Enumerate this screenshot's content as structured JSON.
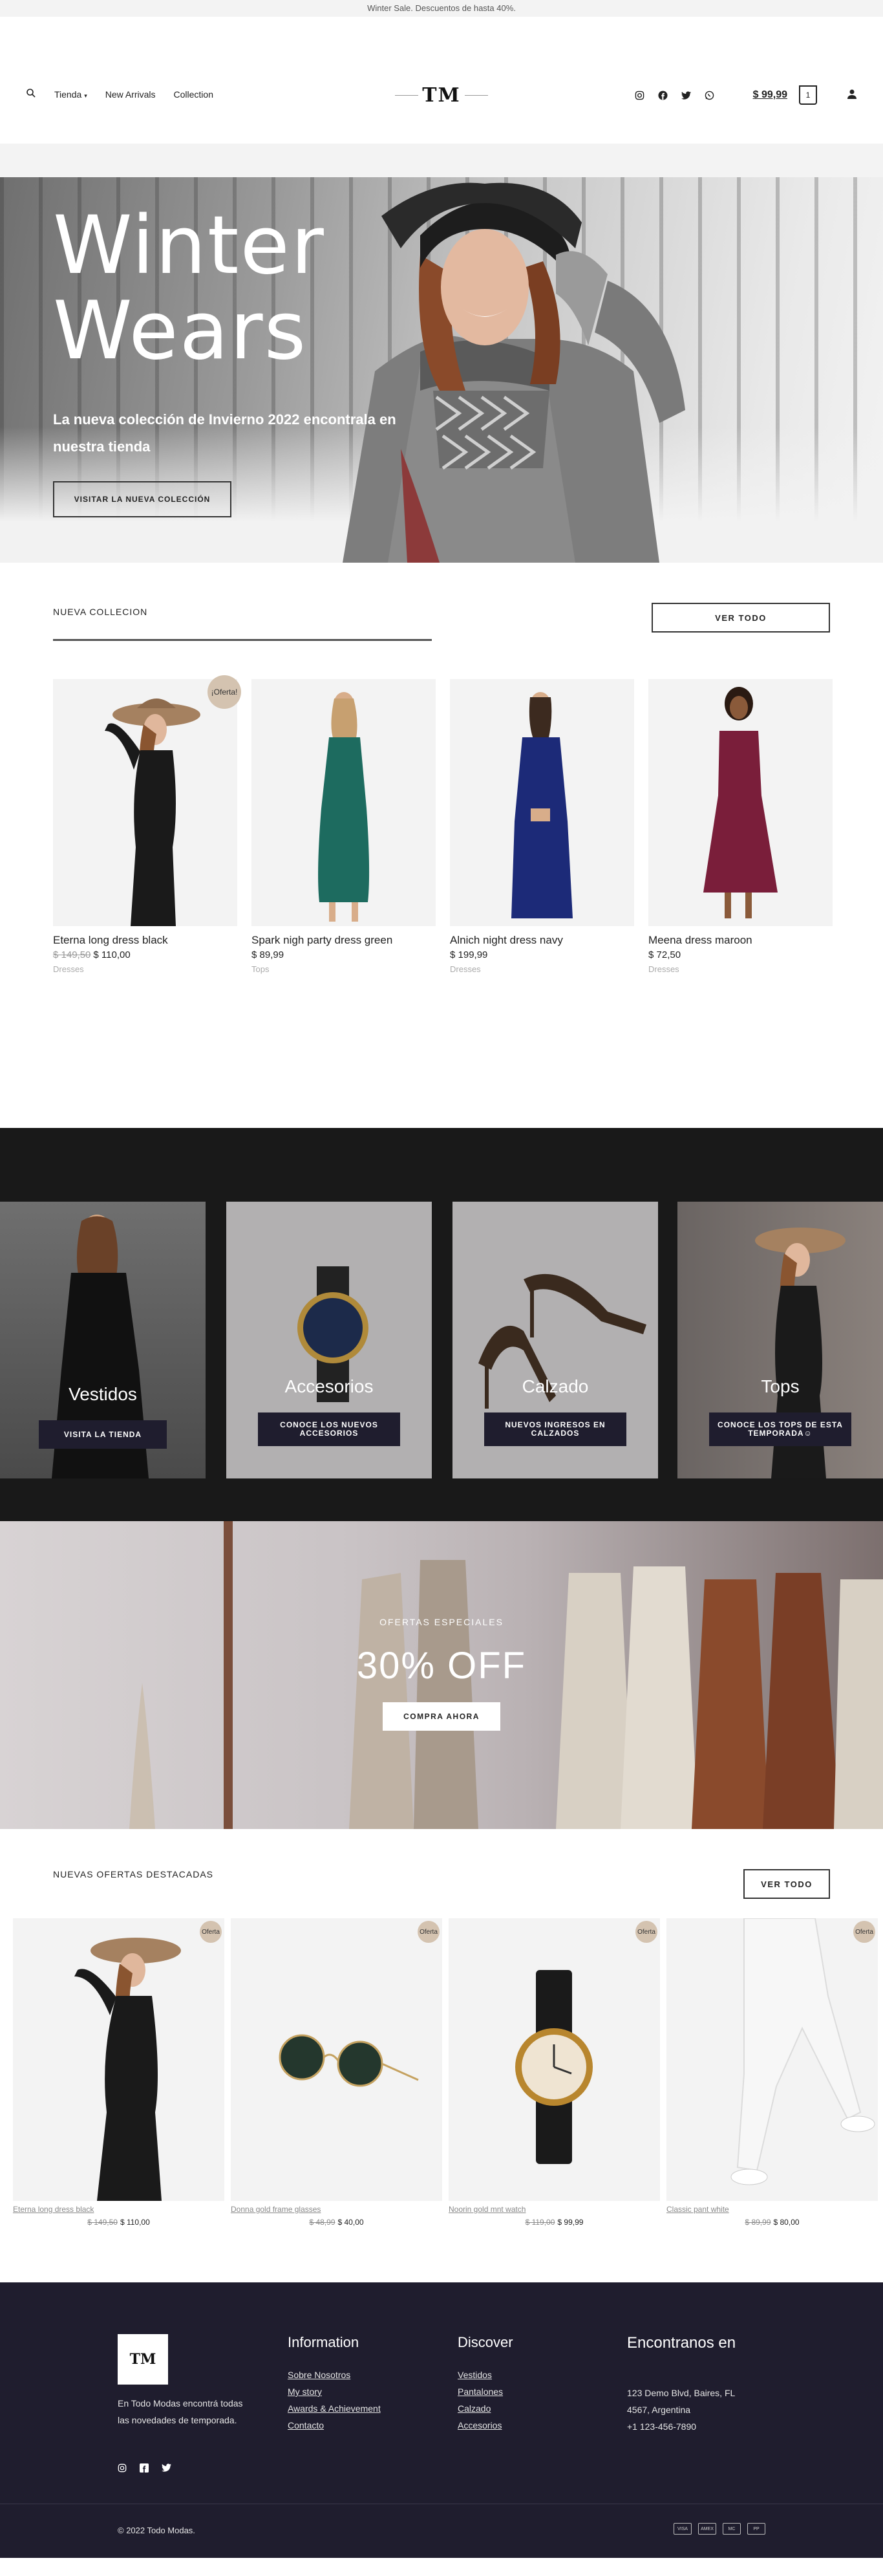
{
  "topbar": {
    "text": "Winter Sale. Descuentos de hasta 40%."
  },
  "header": {
    "nav": [
      "Tienda",
      "New Arrivals",
      "Collection"
    ],
    "logo": "TM",
    "cart_total": "$ 99,99",
    "cart_count": "1"
  },
  "hero": {
    "title_line1": "Winter",
    "title_line2": "Wears",
    "subtitle": "La nueva colección de Invierno 2022 encontrala en nuestra tienda",
    "button": "VISITAR LA NUEVA COLECCIÓN"
  },
  "collection": {
    "title": "NUEVA COLLECION",
    "button": "VER TODO",
    "badge": "¡Oferta!",
    "products": [
      {
        "name": "Eterna long dress black",
        "old_price": "$ 149,50",
        "price": "$ 110,00",
        "category": "Dresses"
      },
      {
        "name": "Spark nigh party dress green",
        "old_price": "",
        "price": "$ 89,99",
        "category": "Tops"
      },
      {
        "name": "Alnich night dress navy",
        "old_price": "",
        "price": "$ 199,99",
        "category": "Dresses"
      },
      {
        "name": "Meena dress maroon",
        "old_price": "",
        "price": "$ 72,50",
        "category": "Dresses"
      }
    ]
  },
  "categories": [
    {
      "label": "Vestidos",
      "button": "VISITA LA TIENDA"
    },
    {
      "label": "Accesorios",
      "button": "CONOCE LOS NUEVOS ACCESORIOS"
    },
    {
      "label": "Calzado",
      "button": "NUEVOS INGRESOS EN CALZADOS"
    },
    {
      "label": "Tops",
      "button": "CONOCE LOS TOPS DE ESTA TEMPORADA☺"
    }
  ],
  "promo": {
    "small": "OFERTAS ESPECIALES",
    "big": "30% OFF",
    "button": "COMPRA AHORA"
  },
  "offers": {
    "title": "NUEVAS OFERTAS DESTACADAS",
    "button": "VER TODO",
    "badge": "Oferta",
    "items": [
      {
        "name": "Eterna long dress black",
        "old_price": "$ 149,50",
        "price": "$ 110,00"
      },
      {
        "name": "Donna gold frame glasses",
        "old_price": "$ 48,99",
        "price": "$ 40,00"
      },
      {
        "name": "Noorin gold mnt watch",
        "old_price": "$ 119,00",
        "price": "$ 99,99"
      },
      {
        "name": "Classic pant white",
        "old_price": "$ 89,99",
        "price": "$ 80,00"
      }
    ]
  },
  "footer": {
    "logo": "TM",
    "about": "En Todo Modas encontrá todas las novedades de temporada.",
    "info_title": "Information",
    "info_links": [
      "Sobre Nosotros",
      "My story",
      "Awards & Achievement",
      "Contacto"
    ],
    "discover_title": "Discover",
    "discover_links": [
      "Vestidos",
      "Pantalones",
      "Calzado",
      "Accesorios"
    ],
    "contact_title": "Encontranos en",
    "address1": "123 Demo Blvd, Baires, FL",
    "address2": "4567, Argentina",
    "phone": "+1 123-456-7890",
    "copyright": "© 2022 Todo Modas.",
    "payments": [
      "VISA",
      "AMEX",
      "MC",
      "PP"
    ]
  }
}
